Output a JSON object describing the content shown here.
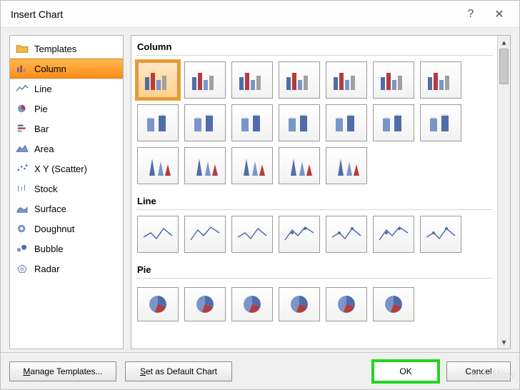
{
  "title": "Insert Chart",
  "help_label": "?",
  "close_label": "✕",
  "sidebar": {
    "items": [
      {
        "label": "Templates",
        "icon": "folder"
      },
      {
        "label": "Column",
        "icon": "column-chart"
      },
      {
        "label": "Line",
        "icon": "line-chart"
      },
      {
        "label": "Pie",
        "icon": "pie-chart"
      },
      {
        "label": "Bar",
        "icon": "bar-chart"
      },
      {
        "label": "Area",
        "icon": "area-chart"
      },
      {
        "label": "X Y (Scatter)",
        "icon": "scatter-chart"
      },
      {
        "label": "Stock",
        "icon": "stock-chart"
      },
      {
        "label": "Surface",
        "icon": "surface-chart"
      },
      {
        "label": "Doughnut",
        "icon": "doughnut-chart"
      },
      {
        "label": "Bubble",
        "icon": "bubble-chart"
      },
      {
        "label": "Radar",
        "icon": "radar-chart"
      }
    ],
    "selected_index": 1
  },
  "sections": [
    {
      "heading": "Column",
      "count": 19,
      "selected_index": 0
    },
    {
      "heading": "Line",
      "count": 7
    },
    {
      "heading": "Pie",
      "count": 6
    }
  ],
  "buttons": {
    "manage_templates": "Manage Templates...",
    "set_default": "Set as Default Chart",
    "ok": "OK",
    "cancel": "Cancel"
  },
  "watermark": "wikiHow",
  "accent": "#ff8c1a",
  "highlight": "#22d522"
}
